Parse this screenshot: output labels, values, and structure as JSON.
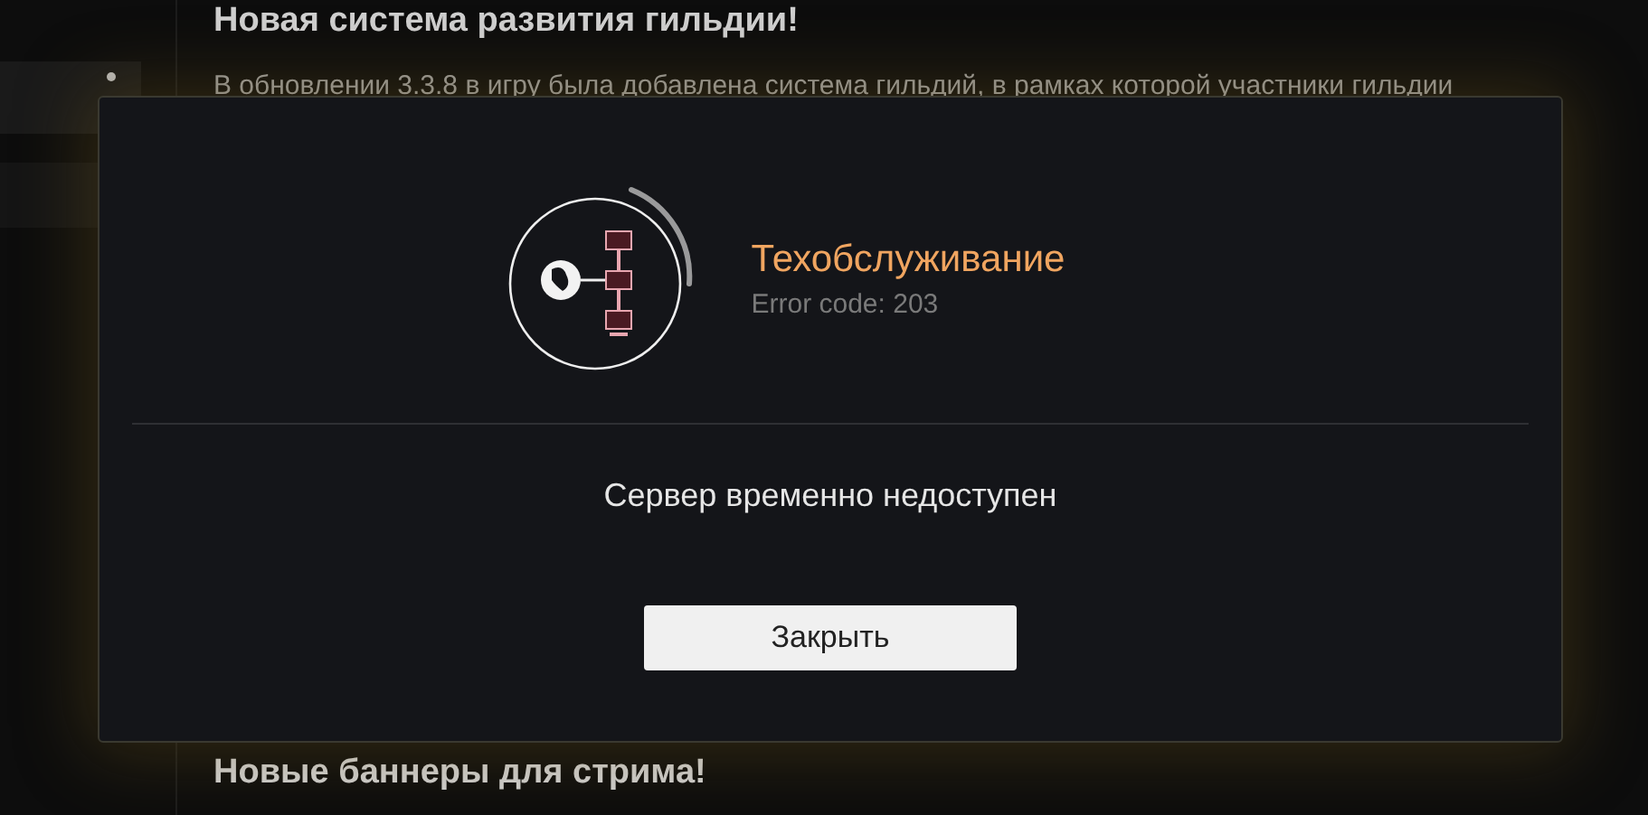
{
  "background": {
    "heading": "Новая система развития гильдии!",
    "paragraph": "В обновлении 3.3.8 в игру была добавлена система гильдий, в рамках которой участники гильдии",
    "next_heading": "Новые баннеры для стрима!"
  },
  "dialog": {
    "title": "Техобслуживание",
    "error_code": "Error code: 203",
    "message": "Сервер временно недоступен",
    "buttons": [
      "Закрыть"
    ]
  }
}
